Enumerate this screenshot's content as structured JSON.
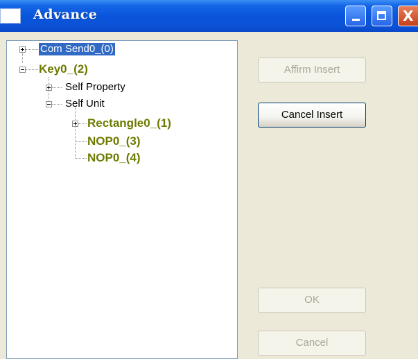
{
  "window": {
    "title": "Advance",
    "controls": {
      "minimize": "minimize",
      "maximize": "maximize",
      "close": "X"
    }
  },
  "tree": {
    "nodes": [
      {
        "label": "Com Send0_(0)"
      },
      {
        "label": "Key0_(2)"
      },
      {
        "label": "Self Property"
      },
      {
        "label": "Self Unit"
      },
      {
        "label": "Rectangle0_(1)"
      },
      {
        "label": "NOP0_(3)"
      },
      {
        "label": "NOP0_(4)"
      }
    ]
  },
  "buttons": {
    "affirm_insert": "Affirm Insert",
    "cancel_insert": "Cancel Insert",
    "ok": "OK",
    "cancel": "Cancel"
  },
  "colors": {
    "titlebar": "#0a55dc",
    "tree_gold": "#6e7a00",
    "selection": "#316ac5"
  }
}
